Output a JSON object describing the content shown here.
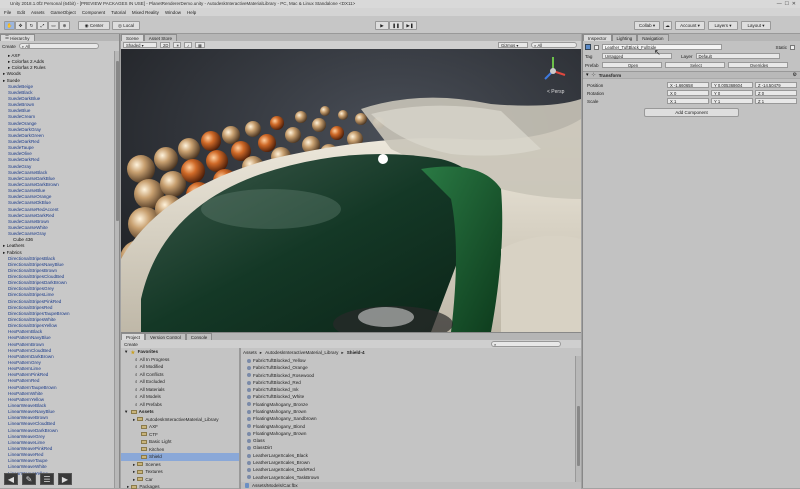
{
  "window": {
    "title": "Unity 2018.1.0f2 Personal (64bit) - [PREVIEW PACKAGES IN USE] - PlanetRendererDemo.unity - AutodeskInteractiveMaterialLibrary - PC, Mac & Linux Standalone <DX11>"
  },
  "menu": [
    "File",
    "Edit",
    "Assets",
    "GameObject",
    "Component",
    "Tutorial",
    "Mixed Reality",
    "Window",
    "Help"
  ],
  "toolbar": {
    "pivot_label": "Center",
    "space_label": "Local",
    "collab_label": "Collab",
    "account_label": "Account",
    "layers_label": "Layers",
    "layout_label": "Layout"
  },
  "hierarchy": {
    "tab_label": "Hierarchy",
    "create_label": "Create",
    "search_placeholder": "All",
    "items": [
      {
        "label": "AXF",
        "indent": 1,
        "color": "black"
      },
      {
        "label": "Colorfas 2 Adds",
        "indent": 1,
        "color": "black"
      },
      {
        "label": "Colorfas 2 Rules",
        "indent": 1,
        "color": "black"
      },
      {
        "label": "Woods",
        "indent": 0,
        "color": "black"
      },
      {
        "label": "Suede",
        "indent": 0,
        "color": "black"
      },
      {
        "label": "SuedeBeige",
        "indent": 1,
        "color": "blue"
      },
      {
        "label": "SuedeBlack",
        "indent": 1,
        "color": "blue"
      },
      {
        "label": "SuedeDarkBlue",
        "indent": 1,
        "color": "blue"
      },
      {
        "label": "SuedeBrown",
        "indent": 1,
        "color": "blue"
      },
      {
        "label": "SuedeBlue",
        "indent": 1,
        "color": "blue"
      },
      {
        "label": "SuedeCream",
        "indent": 1,
        "color": "blue"
      },
      {
        "label": "SuedeOrange",
        "indent": 1,
        "color": "blue"
      },
      {
        "label": "SuedeDarkGray",
        "indent": 1,
        "color": "blue"
      },
      {
        "label": "SuedeDarkGreen",
        "indent": 1,
        "color": "blue"
      },
      {
        "label": "SuedeDarkRed",
        "indent": 1,
        "color": "blue"
      },
      {
        "label": "SuedeTaupe",
        "indent": 1,
        "color": "blue"
      },
      {
        "label": "SuedeOlive",
        "indent": 1,
        "color": "blue"
      },
      {
        "label": "SuedeDarkRed",
        "indent": 1,
        "color": "blue"
      },
      {
        "label": "SuedeGray",
        "indent": 1,
        "color": "blue"
      },
      {
        "label": "SuedeCoarseBlack",
        "indent": 1,
        "color": "blue"
      },
      {
        "label": "SuedeCoarseDarkBlue",
        "indent": 1,
        "color": "blue"
      },
      {
        "label": "SuedeCoarseDarkBrown",
        "indent": 1,
        "color": "blue"
      },
      {
        "label": "SuedeCoarseBlue",
        "indent": 1,
        "color": "blue"
      },
      {
        "label": "SuedeCoarseOrange",
        "indent": 1,
        "color": "blue"
      },
      {
        "label": "SuedeCoarseDkBlue",
        "indent": 1,
        "color": "blue"
      },
      {
        "label": "SuedeCoarseRedAccent",
        "indent": 1,
        "color": "blue"
      },
      {
        "label": "SuedeCoarseDarkRed",
        "indent": 1,
        "color": "blue"
      },
      {
        "label": "SuedeCoarseBrown",
        "indent": 1,
        "color": "blue"
      },
      {
        "label": "SuedeCoarseWhite",
        "indent": 1,
        "color": "blue"
      },
      {
        "label": "SuedeCoarseGray",
        "indent": 1,
        "color": "blue"
      },
      {
        "label": "Cube 436",
        "indent": 2,
        "color": "black"
      },
      {
        "label": "Leathers",
        "indent": 0,
        "color": "black"
      },
      {
        "label": "Fabrics",
        "indent": 0,
        "color": "black"
      },
      {
        "label": "DirectionalStripesBlack",
        "indent": 1,
        "color": "blue"
      },
      {
        "label": "DirectionalStripesNavyBlue",
        "indent": 1,
        "color": "blue"
      },
      {
        "label": "DirectionalStripesBrown",
        "indent": 1,
        "color": "blue"
      },
      {
        "label": "DirectionalStripesCloudBed",
        "indent": 1,
        "color": "blue"
      },
      {
        "label": "DirectionalStripesDarkBrown",
        "indent": 1,
        "color": "blue"
      },
      {
        "label": "DirectionalStripesGrey",
        "indent": 1,
        "color": "blue"
      },
      {
        "label": "DirectionalStripesLime",
        "indent": 1,
        "color": "blue"
      },
      {
        "label": "DirectionalStripesPinkRed",
        "indent": 1,
        "color": "blue"
      },
      {
        "label": "DirectionalStripesRed",
        "indent": 1,
        "color": "blue"
      },
      {
        "label": "DirectionalStripesTaupeBrown",
        "indent": 1,
        "color": "blue"
      },
      {
        "label": "DirectionalStripesWhite",
        "indent": 1,
        "color": "blue"
      },
      {
        "label": "DirectionalStripesYellow",
        "indent": 1,
        "color": "blue"
      },
      {
        "label": "HexPatternBlack",
        "indent": 1,
        "color": "blue"
      },
      {
        "label": "HexPatternNavyBlue",
        "indent": 1,
        "color": "blue"
      },
      {
        "label": "HexPatternBrown",
        "indent": 1,
        "color": "blue"
      },
      {
        "label": "HexPatternCloudBed",
        "indent": 1,
        "color": "blue"
      },
      {
        "label": "HexPatternDarkBrown",
        "indent": 1,
        "color": "blue"
      },
      {
        "label": "HexPatternGrey",
        "indent": 1,
        "color": "blue"
      },
      {
        "label": "HexPatternLime",
        "indent": 1,
        "color": "blue"
      },
      {
        "label": "HexPatternPinkRed",
        "indent": 1,
        "color": "blue"
      },
      {
        "label": "HexPatternRed",
        "indent": 1,
        "color": "blue"
      },
      {
        "label": "HexPatternTaupeBrown",
        "indent": 1,
        "color": "blue"
      },
      {
        "label": "HexPatternWhite",
        "indent": 1,
        "color": "blue"
      },
      {
        "label": "HexPatternYellow",
        "indent": 1,
        "color": "blue"
      },
      {
        "label": "LinearWeaveBlack",
        "indent": 1,
        "color": "blue"
      },
      {
        "label": "LinearWeaveNavyBlue",
        "indent": 1,
        "color": "blue"
      },
      {
        "label": "LinearWeaveBrown",
        "indent": 1,
        "color": "blue"
      },
      {
        "label": "LinearWeaveCloudBed",
        "indent": 1,
        "color": "blue"
      },
      {
        "label": "LinearWeaveDarkBrown",
        "indent": 1,
        "color": "blue"
      },
      {
        "label": "LinearWeaveGrey",
        "indent": 1,
        "color": "blue"
      },
      {
        "label": "LinearWeaveLime",
        "indent": 1,
        "color": "blue"
      },
      {
        "label": "LinearWeavePinkRed",
        "indent": 1,
        "color": "blue"
      },
      {
        "label": "LinearWeaveRed",
        "indent": 1,
        "color": "blue"
      },
      {
        "label": "LinearWeaveTaupe",
        "indent": 1,
        "color": "blue"
      },
      {
        "label": "LinearWeaveWhite",
        "indent": 1,
        "color": "blue"
      },
      {
        "label": "LinearWeaveYellow",
        "indent": 1,
        "color": "blue"
      }
    ]
  },
  "scene": {
    "tabs": [
      "Scene",
      "Asset Store"
    ],
    "shading_label": "Shaded",
    "gizmos_label": "Gizmos",
    "search_placeholder": "All",
    "persp_label": "< Persp"
  },
  "inspector": {
    "tabs": [
      "Inspector",
      "Lighting",
      "Navigation"
    ],
    "object_name": "Leather_TuftBlack_FullSide",
    "static_label": "Static",
    "tag_label": "Tag",
    "tag_value": "Untagged",
    "layer_label": "Layer",
    "layer_value": "Default",
    "prefab_label": "Prefab",
    "prefab_buttons": [
      "Open",
      "Select",
      "Overrides"
    ],
    "transform_label": "Transform",
    "position_label": "Position",
    "rotation_label": "Rotation",
    "scale_label": "Scale",
    "position": {
      "x": "X -1.660658",
      "y": "Y 0.005368604",
      "z": "Z -14.50479"
    },
    "rotation": {
      "x": "X 0",
      "y": "Y 0",
      "z": "Z 0"
    },
    "scale": {
      "x": "X 1",
      "y": "Y 1",
      "z": "Z 1"
    },
    "add_component_label": "Add Component"
  },
  "project": {
    "tabs": [
      "Project",
      "Version Control",
      "Console"
    ],
    "create_label": "Create",
    "favorites_label": "Favorites",
    "favorites": [
      "All In Progress",
      "All Modified",
      "All Conflicts",
      "All Excluded",
      "All Materials",
      "All Models",
      "All Prefabs"
    ],
    "assets_label": "Assets",
    "tree": [
      {
        "label": "AutodeskInteractiveMaterial_Library",
        "indent": 1
      },
      {
        "label": "AXF",
        "indent": 2
      },
      {
        "label": "CTF",
        "indent": 2
      },
      {
        "label": "Basic Light",
        "indent": 2
      },
      {
        "label": "Kitchen",
        "indent": 2
      },
      {
        "label": "Shield",
        "indent": 2,
        "selected": true
      },
      {
        "label": "Scenes",
        "indent": 1
      },
      {
        "label": "Textures",
        "indent": 1
      },
      {
        "label": "Car",
        "indent": 1
      },
      {
        "label": "Packages",
        "indent": 0
      }
    ],
    "breadcrumb": [
      "Assets",
      "AutodeskInteractiveMaterial_Library",
      "Shield-4"
    ],
    "files": [
      "FabricTuftBlocked_Yellow",
      "FabricTuftBlocked_Orange",
      "FabricTuftBlocked_Rosewood",
      "FabricTuftBlocked_Red",
      "FabricTuftBlocked_Ink",
      "FabricTuftBlocked_White",
      "FloatingMahogany_Bronze",
      "FloatingMahogany_Brown",
      "FloatingMahogany_Sandbrown",
      "FloatingMahogany_Blond",
      "FloatingMahogany_Brown",
      "Glass",
      "GlassDirt",
      "LeatherLargeScales_Black",
      "LeatherLargeScales_Brown",
      "LeatherLargeScales_DarkRed",
      "LeatherLargeScales_TaskBrown"
    ],
    "status_path": "Assets/Models/Car.fbx"
  }
}
